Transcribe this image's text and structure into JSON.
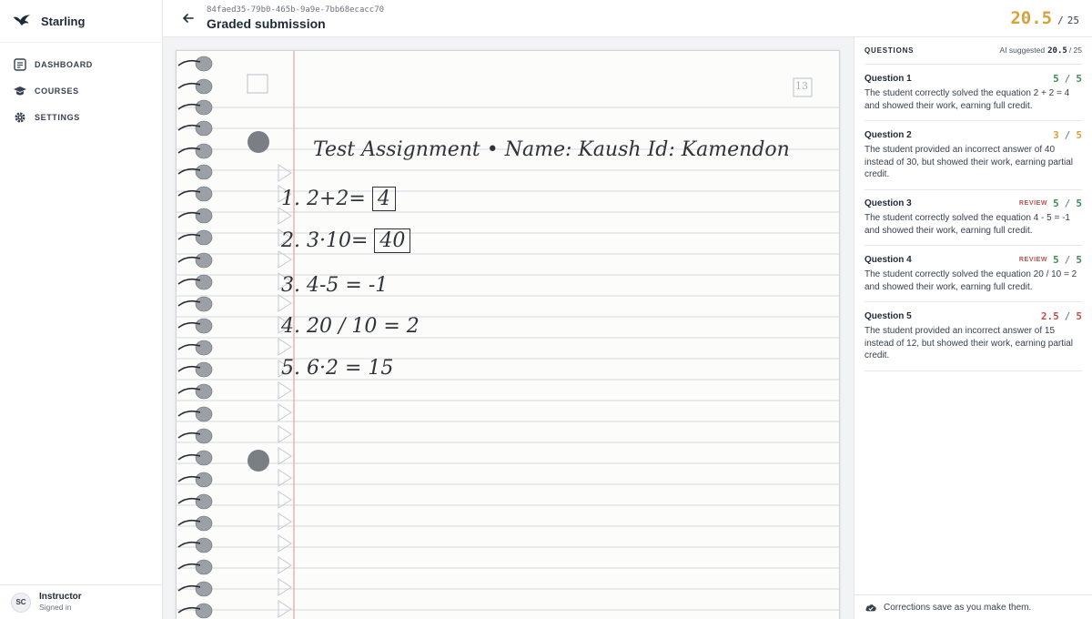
{
  "brand": {
    "name": "Starling"
  },
  "sidebar": {
    "items": [
      {
        "label": "DASHBOARD",
        "icon": "dashboard-icon"
      },
      {
        "label": "COURSES",
        "icon": "courses-icon"
      },
      {
        "label": "SETTINGS",
        "icon": "gear-icon"
      }
    ]
  },
  "user": {
    "initials": "SC",
    "name": "Instructor",
    "status": "Signed in"
  },
  "header": {
    "submission_id": "84faed35-79b0-465b-9a9e-7bb68ecacc70",
    "title": "Graded submission",
    "total_score": "20.5",
    "total_sep": "/",
    "total_max": "25"
  },
  "document": {
    "page_number": "13",
    "heading": "Test Assignment • Name: Kaush Id: Kamendon",
    "lines": [
      {
        "num": "1.",
        "work": "2+2=",
        "answer": "4"
      },
      {
        "num": "2.",
        "work": "3·10=",
        "answer": "40"
      },
      {
        "num": "3.",
        "work": "4-5 = -1",
        "answer": ""
      },
      {
        "num": "4.",
        "work": "20 / 10 = 2",
        "answer": ""
      },
      {
        "num": "5.",
        "work": "6·2 = 15",
        "answer": ""
      }
    ]
  },
  "panel": {
    "label": "QUESTIONS",
    "ai_prefix": "AI suggested",
    "ai_score": "20.5",
    "ai_max": "/ 25",
    "questions": [
      {
        "name": "Question 1",
        "review": "",
        "score": "5",
        "sep": "/",
        "max": "5",
        "color": "#3e8c5a",
        "text": "The student correctly solved the equation 2 + 2 = 4 and showed their work, earning full credit."
      },
      {
        "name": "Question 2",
        "review": "",
        "score": "3",
        "sep": "/",
        "max": "5",
        "color": "#d6a23a",
        "text": "The student provided an incorrect answer of 40 instead of 30, but showed their work, earning partial credit."
      },
      {
        "name": "Question 3",
        "review": "REVIEW",
        "score": "5",
        "sep": "/",
        "max": "5",
        "color": "#3e8c5a",
        "text": "The student correctly solved the equation 4 - 5 = -1 and showed their work, earning full credit."
      },
      {
        "name": "Question 4",
        "review": "REVIEW",
        "score": "5",
        "sep": "/",
        "max": "5",
        "color": "#3e8c5a",
        "text": "The student correctly solved the equation 20 / 10 = 2 and showed their work, earning full credit."
      },
      {
        "name": "Question 5",
        "review": "",
        "score": "2.5",
        "sep": "/",
        "max": "5",
        "color": "#c0504d",
        "text": "The student provided an incorrect answer of 15 instead of 12, but showed their work, earning partial credit."
      }
    ],
    "footer_text": "Corrections save as you make them."
  },
  "colors": {
    "accent_gold": "#d6a23a",
    "green": "#3e8c5a",
    "red": "#c0504d",
    "review": "#b45353"
  }
}
